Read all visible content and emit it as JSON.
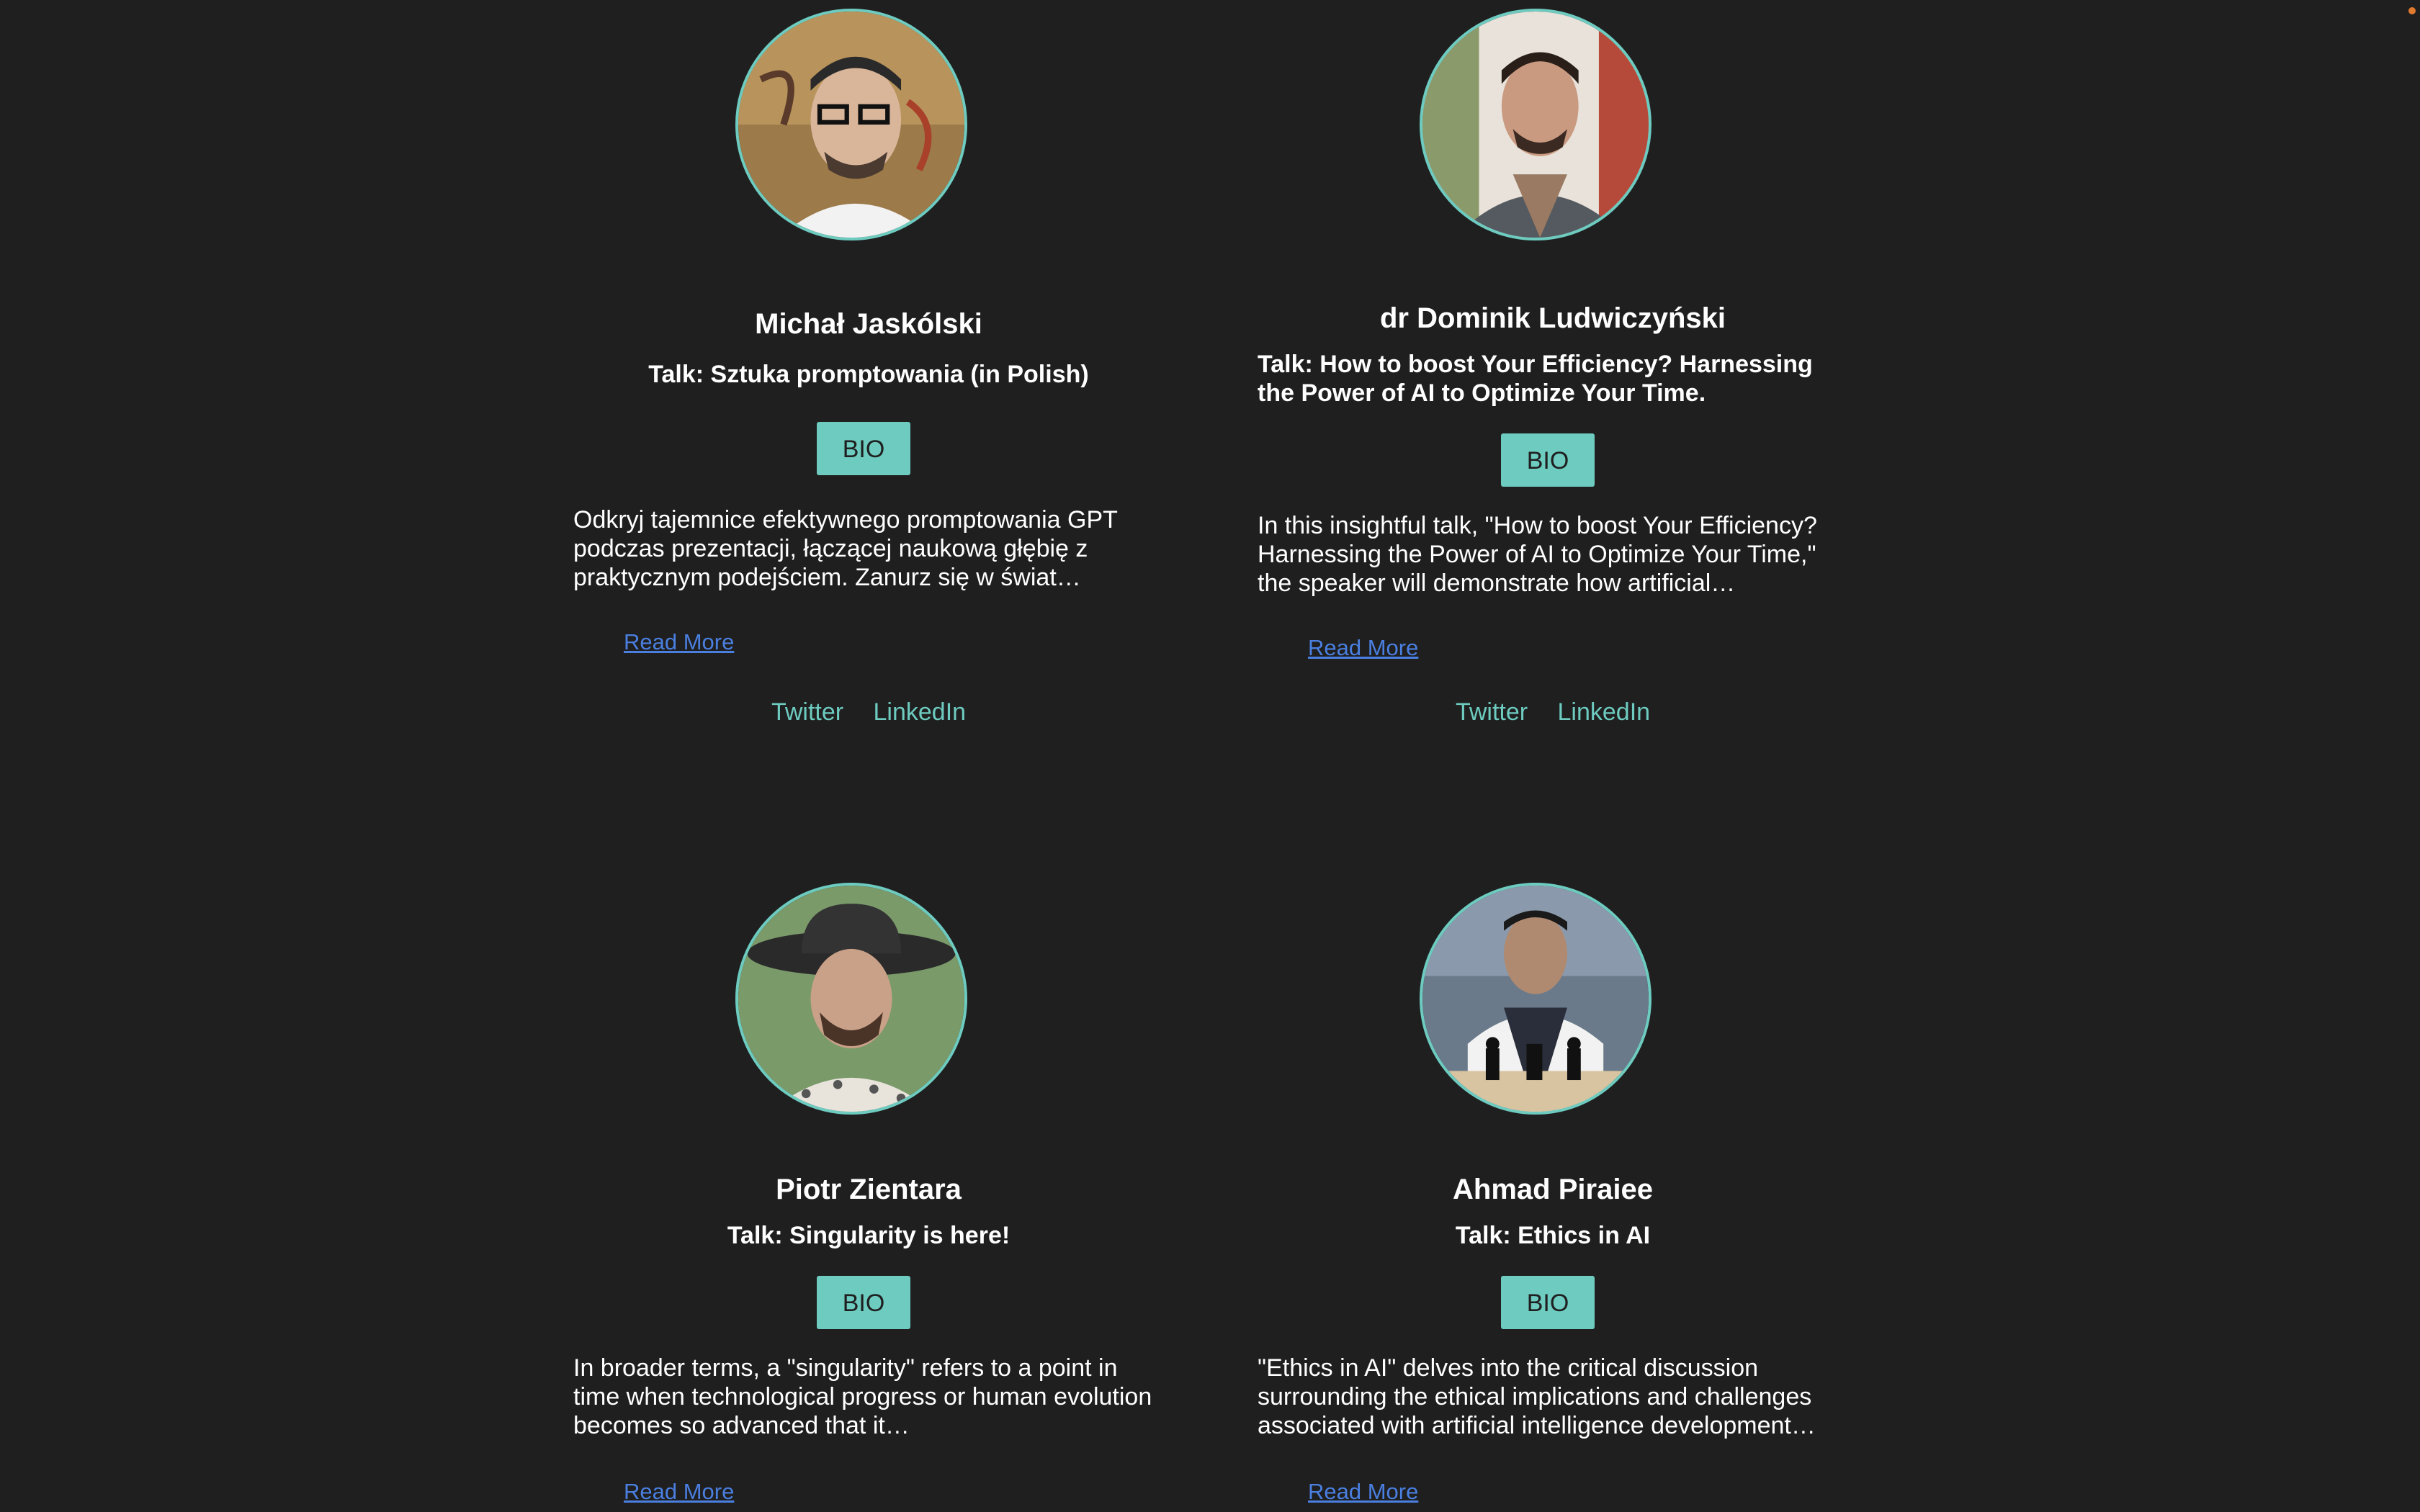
{
  "speakers": [
    {
      "name": "Michał Jaskólski",
      "talk": "Talk: Sztuka promptowania (in Polish)",
      "bio_label": "BIO",
      "description": "Odkryj tajemnice efektywnego promptowania GPT podczas prezentacji, łączącej naukową głębię z praktycznym podejściem. Zanurz się w świat…",
      "read_more": "Read More",
      "twitter": "Twitter",
      "linkedin": "LinkedIn"
    },
    {
      "name": "dr Dominik Ludwiczyński",
      "talk": "Talk: How to boost Your Efficiency? Harnessing the Power of AI to Optimize Your Time.",
      "bio_label": "BIO",
      "description": "In this insightful talk, \"How to boost Your Efficiency? Harnessing the Power of AI to Optimize Your Time,\" the speaker will demonstrate how artificial…",
      "read_more": "Read More",
      "twitter": "Twitter",
      "linkedin": "LinkedIn"
    },
    {
      "name": "Piotr Zientara",
      "talk": "Talk: Singularity is here!",
      "bio_label": "BIO",
      "description": "In broader terms, a \"singularity\" refers to a point in time when technological progress or human evolution becomes so advanced that it…",
      "read_more": "Read More"
    },
    {
      "name": "Ahmad Piraiee",
      "talk": "Talk: Ethics in AI",
      "bio_label": "BIO",
      "description": "\"Ethics in AI\" delves into the critical discussion surrounding the ethical implications and challenges associated with artificial intelligence development…",
      "read_more": "Read More"
    }
  ],
  "colors": {
    "background": "#1f1f1f",
    "accent": "#6dcbc0",
    "link": "#4a7fe0"
  }
}
